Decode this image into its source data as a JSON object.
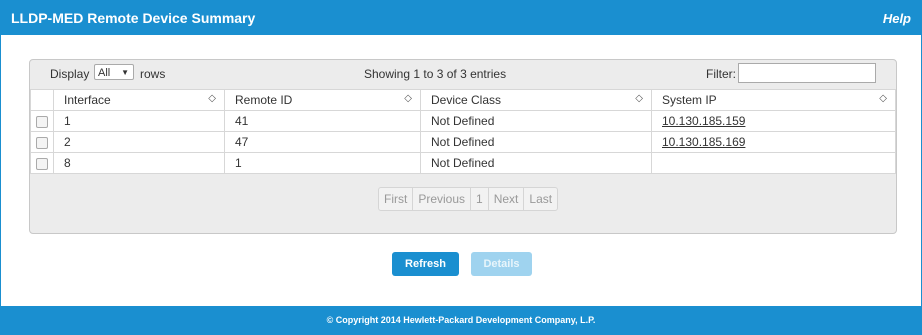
{
  "window": {
    "title": "LLDP-MED Remote Device Summary",
    "help_label": "Help"
  },
  "toolbar": {
    "display_label": "Display",
    "display_value": "All",
    "rows_label": "rows",
    "showing_text": "Showing 1 to 3 of 3 entries",
    "filter_label": "Filter:",
    "filter_value": ""
  },
  "table": {
    "columns": [
      "Interface",
      "Remote ID",
      "Device Class",
      "System IP"
    ],
    "rows": [
      {
        "interface": "1",
        "remote_id": "41",
        "device_class": "Not Defined",
        "system_ip": "10.130.185.159"
      },
      {
        "interface": "2",
        "remote_id": "47",
        "device_class": "Not Defined",
        "system_ip": "10.130.185.169"
      },
      {
        "interface": "8",
        "remote_id": "1",
        "device_class": "Not Defined",
        "system_ip": ""
      }
    ]
  },
  "pagination": {
    "first": "First",
    "previous": "Previous",
    "page": "1",
    "next": "Next",
    "last": "Last"
  },
  "actions": {
    "refresh_label": "Refresh",
    "details_label": "Details"
  },
  "footer": {
    "copyright": "© Copyright 2014 Hewlett-Packard Development Company, L.P."
  },
  "colors": {
    "brand": "#1a8fd0",
    "disabled_button": "#9fd3ef"
  }
}
